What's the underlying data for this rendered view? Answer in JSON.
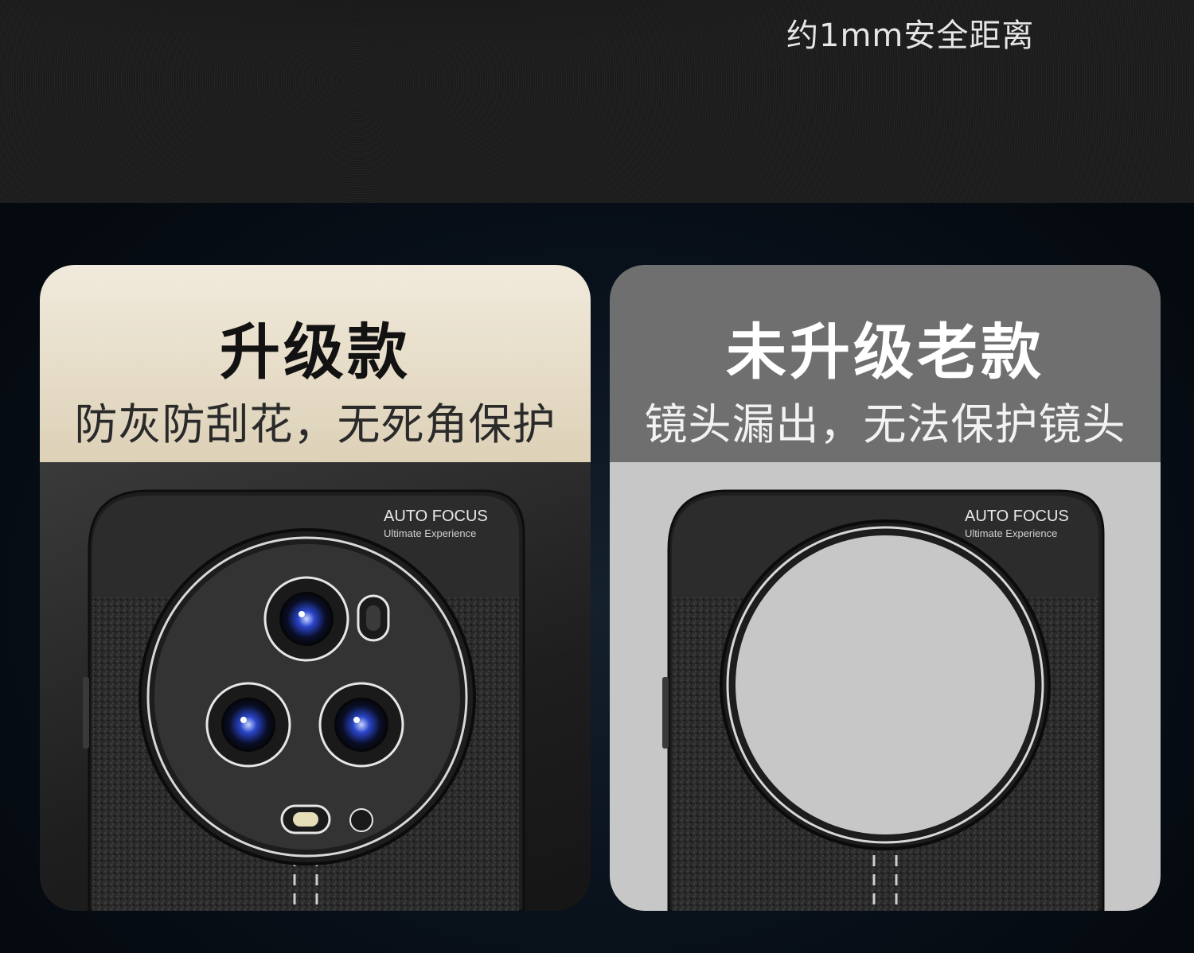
{
  "top": {
    "caption": "约1mm安全距离"
  },
  "cards": [
    {
      "title": "升级款",
      "subtitle": "防灰防刮花，无死角保护",
      "brand_line1": "AUTO FOCUS",
      "brand_line2": "Ultimate Experience"
    },
    {
      "title": "未升级老款",
      "subtitle": "镜头漏出，无法保护镜头",
      "brand_line1": "AUTO FOCUS",
      "brand_line2": "Ultimate Experience"
    }
  ],
  "colors": {
    "upgraded_header": "#ede4d1",
    "old_header": "#6f6f6f",
    "lens_blue": "#2a45c9"
  }
}
